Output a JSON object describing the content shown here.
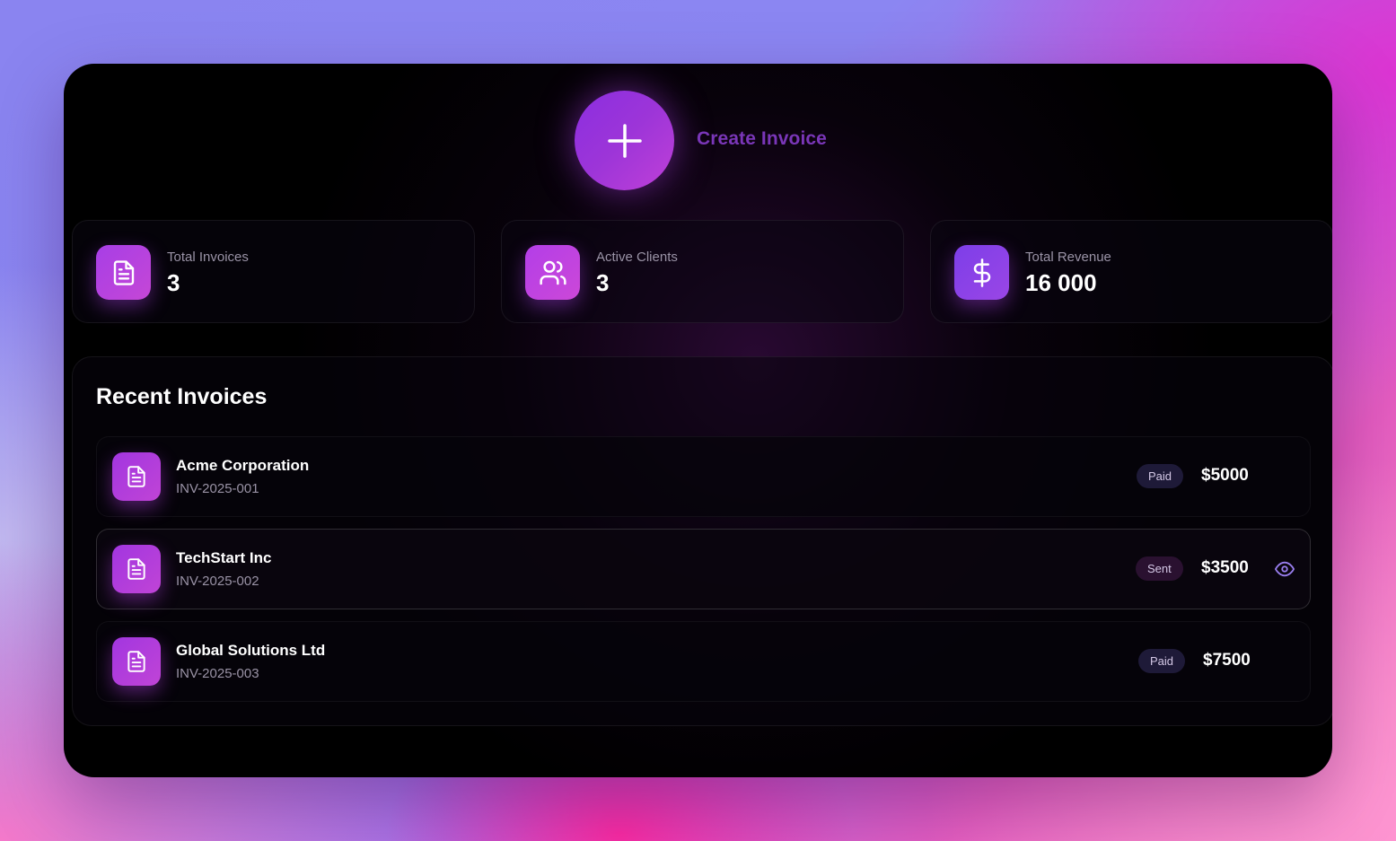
{
  "header": {
    "create_label": "Create Invoice",
    "create_icon": "plus-icon"
  },
  "stats": [
    {
      "label": "Total Invoices",
      "value": "3",
      "icon": "document-icon",
      "gradient": [
        "#a73ee6",
        "#c547d6"
      ]
    },
    {
      "label": "Active Clients",
      "value": "3",
      "icon": "users-icon",
      "gradient": [
        "#b33ee8",
        "#cc48d8"
      ]
    },
    {
      "label": "Total Revenue",
      "value": "16 000",
      "icon": "dollar-icon",
      "gradient": [
        "#7d3ee8",
        "#9a46e6"
      ]
    }
  ],
  "recent": {
    "title": "Recent Invoices",
    "invoices": [
      {
        "client": "Acme Corporation",
        "number": "INV-2025-001",
        "status": "Paid",
        "amount": "$5000"
      },
      {
        "client": "TechStart Inc",
        "number": "INV-2025-002",
        "status": "Sent",
        "amount": "$3500",
        "view_icon": "eye-icon"
      },
      {
        "client": "Global Solutions Ltd",
        "number": "INV-2025-003",
        "status": "Paid",
        "amount": "$7500"
      }
    ]
  },
  "colors": {
    "accent": "#9b35dc",
    "create_label": "#7a36b8",
    "paid_badge": "#1e1a38",
    "sent_badge": "#2a1130"
  }
}
